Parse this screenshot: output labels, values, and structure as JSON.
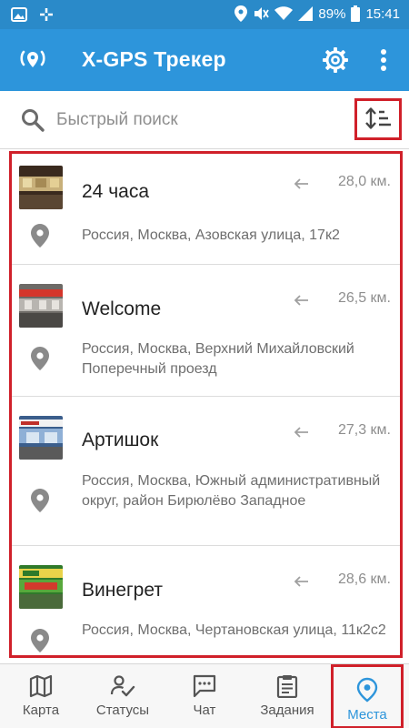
{
  "status_bar": {
    "battery": "89%",
    "time": "15:41"
  },
  "app_bar": {
    "title": "X-GPS Трекер"
  },
  "search": {
    "placeholder": "Быстрый поиск"
  },
  "places": [
    {
      "name": "24 часа",
      "distance": "28,0 км.",
      "address": "Россия, Москва, Азовская улица, 17к2"
    },
    {
      "name": "Welcome",
      "distance": "26,5 км.",
      "address": "Россия, Москва, Верхний Михайловский Поперечный проезд"
    },
    {
      "name": "Артишок",
      "distance": "27,3 км.",
      "address": "Россия, Москва, Южный административный округ, район Бирюлёво Западное"
    },
    {
      "name": "Винегрет",
      "distance": "28,6 км.",
      "address": "Россия, Москва, Чертановская улица, 11к2с2"
    }
  ],
  "bottom_nav": {
    "items": [
      {
        "label": "Карта",
        "icon": "map-icon"
      },
      {
        "label": "Статусы",
        "icon": "status-check-icon"
      },
      {
        "label": "Чат",
        "icon": "chat-icon"
      },
      {
        "label": "Задания",
        "icon": "clipboard-icon"
      },
      {
        "label": "Места",
        "icon": "location-pin-icon"
      }
    ],
    "active_index": 4
  },
  "colors": {
    "primary": "#2d95db",
    "status_bar": "#2a8ac9",
    "highlight": "#d0202a"
  }
}
